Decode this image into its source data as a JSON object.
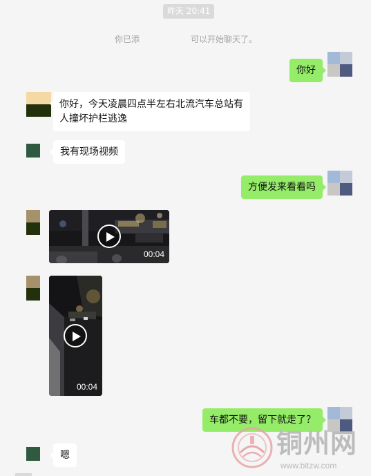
{
  "time_tag": "昨天 20:41",
  "system_message": {
    "prefix": "你已添",
    "suffix": "可以开始聊天了。"
  },
  "messages": [
    {
      "side": "right",
      "text": "你好"
    },
    {
      "side": "left",
      "text_line1": "你好，今天凌晨四点半左右北流汽车总站有",
      "text_line2": "人撞坏护栏逃逸"
    },
    {
      "side": "left",
      "text": "我有现场视频"
    },
    {
      "side": "right",
      "text": "方便发来看看吗"
    },
    {
      "side": "left",
      "type": "video",
      "duration": "00:04"
    },
    {
      "side": "left",
      "type": "video",
      "duration": "00:04"
    },
    {
      "side": "right",
      "text": "车都不要，留下就走了？"
    },
    {
      "side": "left",
      "text": "嗯"
    }
  ],
  "watermark": {
    "title": "铜州网",
    "url": "www.bltzw.com"
  },
  "colors": {
    "background": "#f5f5f5",
    "bubble_self": "#95ec69",
    "bubble_other": "#ffffff",
    "time_tag_bg": "#dadada",
    "system_text": "#a6a6a6"
  },
  "icons": [
    "play-icon",
    "bubble-tail-icon",
    "watermark-emblem-icon"
  ]
}
